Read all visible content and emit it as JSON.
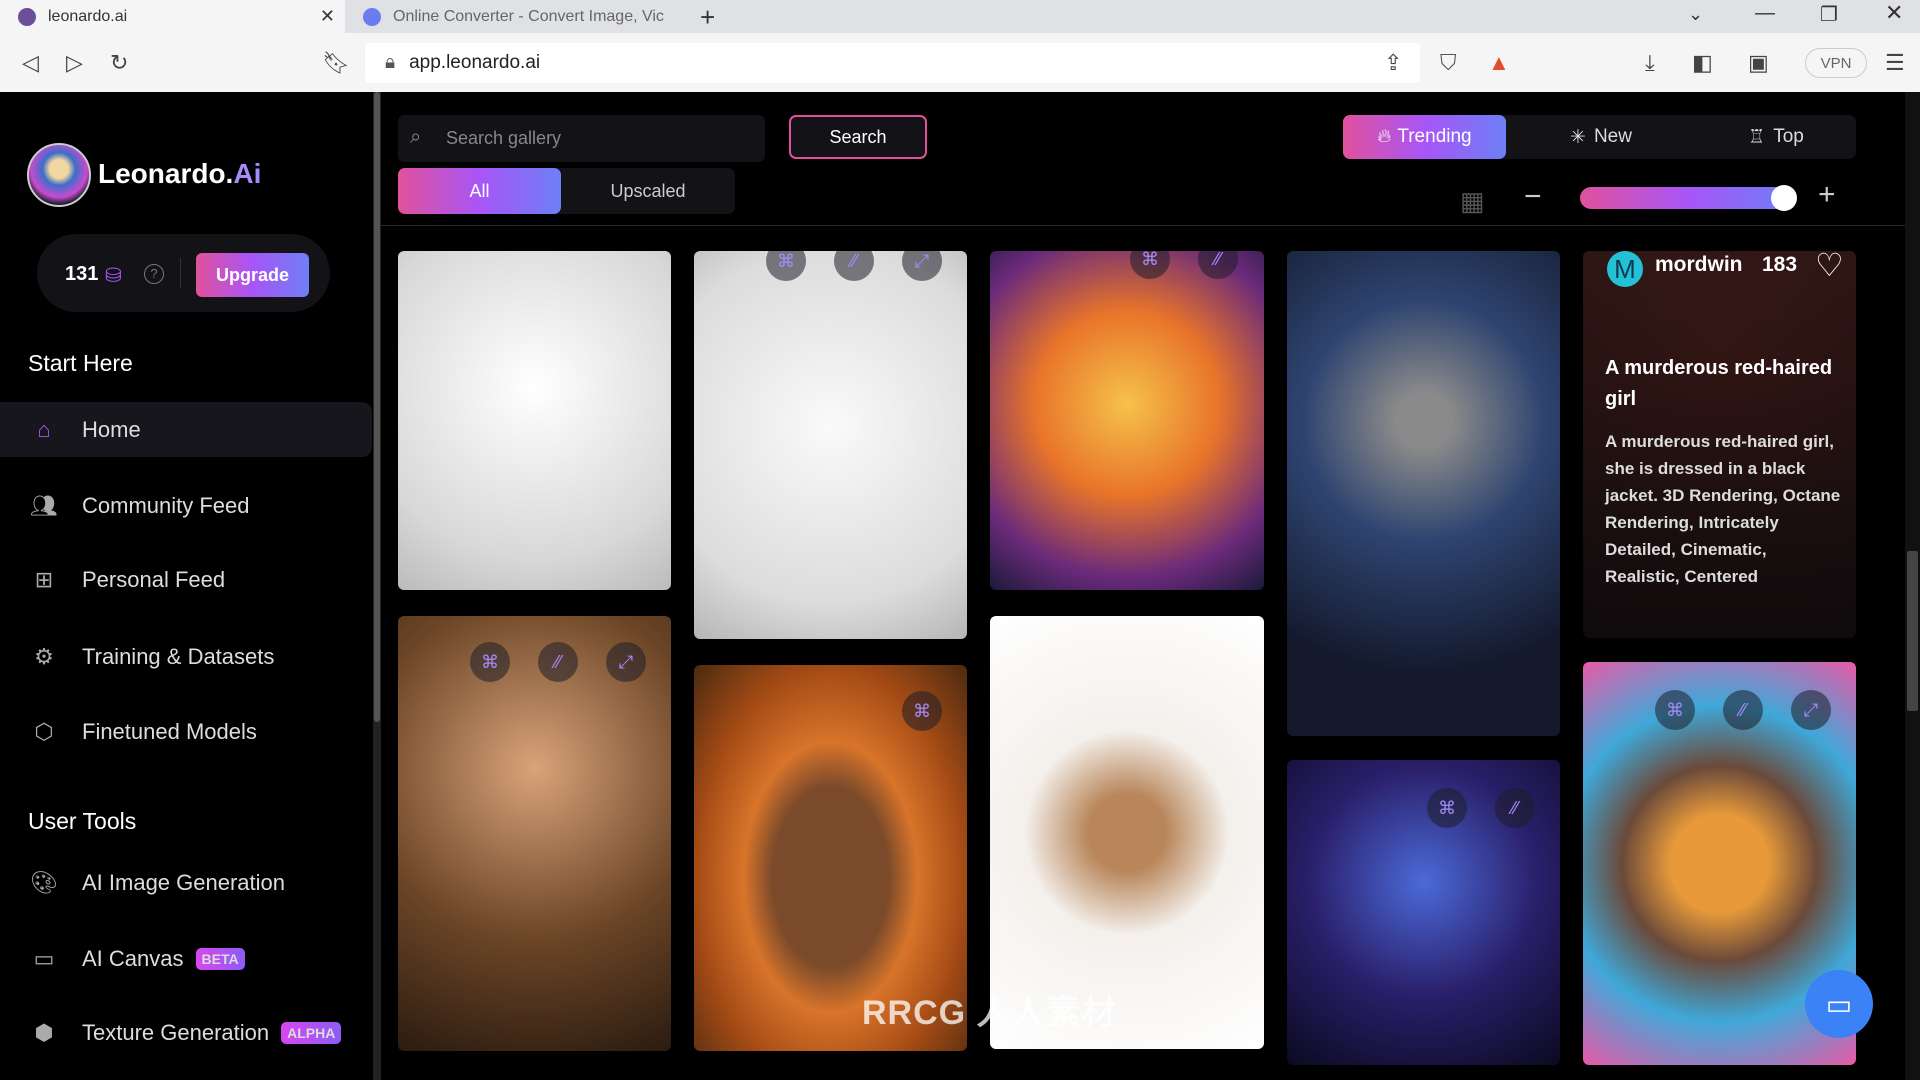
{
  "browser": {
    "tabs": [
      {
        "title": "leonardo.ai",
        "active": true
      },
      {
        "title": "Online Converter - Convert Image, Vic",
        "active": false
      }
    ],
    "url": "app.leonardo.ai",
    "vpn_label": "VPN"
  },
  "sidebar": {
    "brand": "Leonardo.",
    "brand_accent": "Ai",
    "credits": "131",
    "upgrade": "Upgrade",
    "section_start": "Start Here",
    "section_tools": "User Tools",
    "items": [
      {
        "label": "Home",
        "icon": "home-icon",
        "active": true
      },
      {
        "label": "Community Feed",
        "icon": "users-icon"
      },
      {
        "label": "Personal Feed",
        "icon": "grid-icon"
      },
      {
        "label": "Training & Datasets",
        "icon": "brain-icon"
      },
      {
        "label": "Finetuned Models",
        "icon": "cube-icon"
      },
      {
        "label": "AI Image Generation",
        "icon": "palette-icon"
      },
      {
        "label": "AI Canvas",
        "icon": "easel-icon",
        "badge": "BETA"
      },
      {
        "label": "Texture Generation",
        "icon": "texture-icon",
        "badge": "ALPHA"
      }
    ]
  },
  "toolbar": {
    "search_placeholder": "Search gallery",
    "search_button": "Search",
    "filters": [
      "All",
      "Upscaled"
    ],
    "active_filter": "All",
    "sort": [
      "Trending",
      "New",
      "Top"
    ],
    "active_sort": "Trending",
    "zoom_level_percent": 95
  },
  "hover_card": {
    "user_initial": "M",
    "username": "mordwin",
    "likes": "183",
    "title": "A murderous red-haired girl",
    "prompt": "A murderous red-haired girl, she is dressed in a black jacket. 3D Rendering, Octane Rendering, Intricately Detailed, Cinematic, Realistic, Centered"
  },
  "watermark": "RRCG 人人素材",
  "colors": {
    "accent_start": "#e0529c",
    "accent_mid": "#a855f7",
    "accent_end": "#6d7ff5"
  }
}
